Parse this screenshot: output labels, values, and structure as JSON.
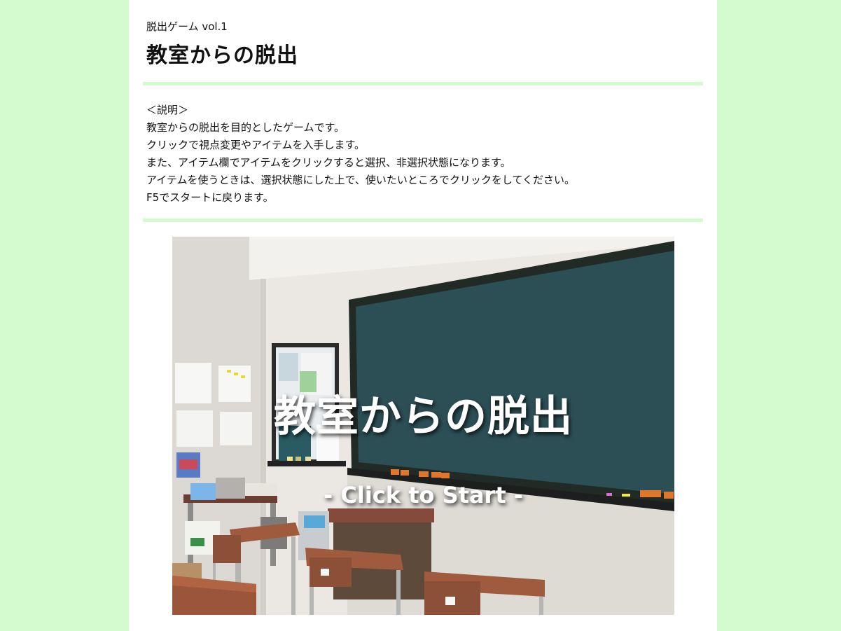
{
  "header": {
    "subtitle": "脱出ゲーム vol.1",
    "title": "教室からの脱出"
  },
  "description": {
    "lines": [
      "＜説明＞",
      "教室からの脱出を目的としたゲームです。",
      "クリックで視点変更やアイテムを入手します。",
      "また、アイテム欄でアイテムをクリックすると選択、非選択状態になります。",
      "アイテムを使うときは、選択状態にした上で、使いたいところでクリックをしてください。",
      "F5でスタートに戻ります。"
    ]
  },
  "game": {
    "title": "教室からの脱出",
    "start_label": "- Click to Start -",
    "scene": "classroom-with-blackboard"
  },
  "colors": {
    "background": "#d4fbd0",
    "panel": "#ffffff",
    "rule": "#d4fbd0",
    "blackboard": "#2c4f55"
  }
}
